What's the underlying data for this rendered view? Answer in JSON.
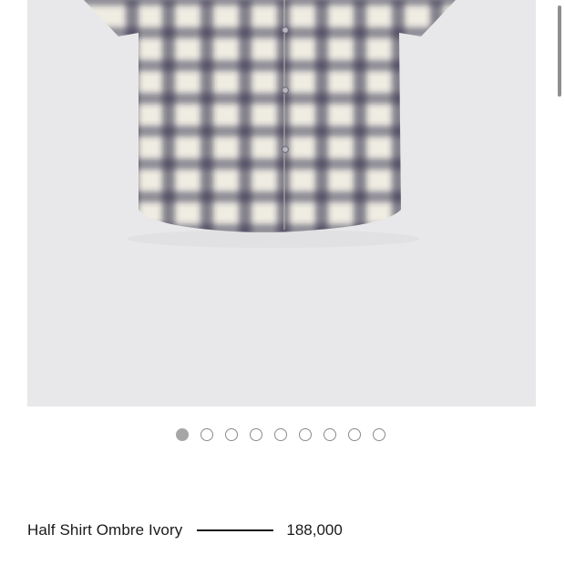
{
  "product": {
    "name": "Half Shirt Ombre Ivory",
    "price": "188,000",
    "image_alt": "Half Shirt Ombre Ivory"
  },
  "carousel": {
    "total": 9,
    "active_index": 0
  },
  "colors": {
    "image_background": "#e8e8ea",
    "shirt_base": "#efece2",
    "check_dark": "#2c2a45",
    "text": "#1a1a1a",
    "dot_active": "#a6a6a6"
  }
}
